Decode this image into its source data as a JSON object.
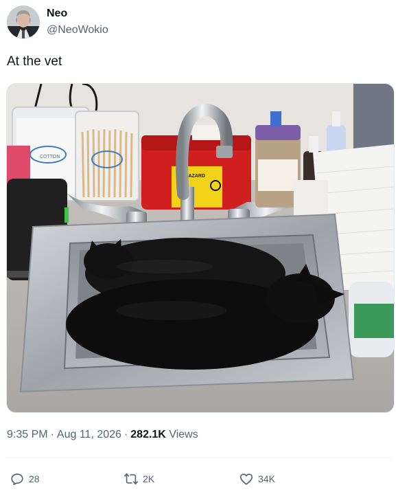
{
  "author": {
    "display_name": "Neo",
    "handle": "@NeoWokio",
    "avatar_icon": "profile-avatar"
  },
  "tweet": {
    "text": "At the vet"
  },
  "meta": {
    "time": "9:35 PM",
    "date": "Aug 11, 2026",
    "separator": "·",
    "views_count": "282.1K",
    "views_label": "Views"
  },
  "actions": {
    "reply_icon": "reply-icon",
    "reply_count": "28",
    "repost_icon": "repost-icon",
    "repost_count": "2K",
    "like_icon": "heart-icon",
    "like_count": "34K"
  },
  "media": {
    "jar_label": "COTTON",
    "container_label": "BIOHAZARD",
    "colors": {
      "sink": "#b9bcbf",
      "cat": "#121212",
      "sharps": "#d11f1f"
    }
  }
}
